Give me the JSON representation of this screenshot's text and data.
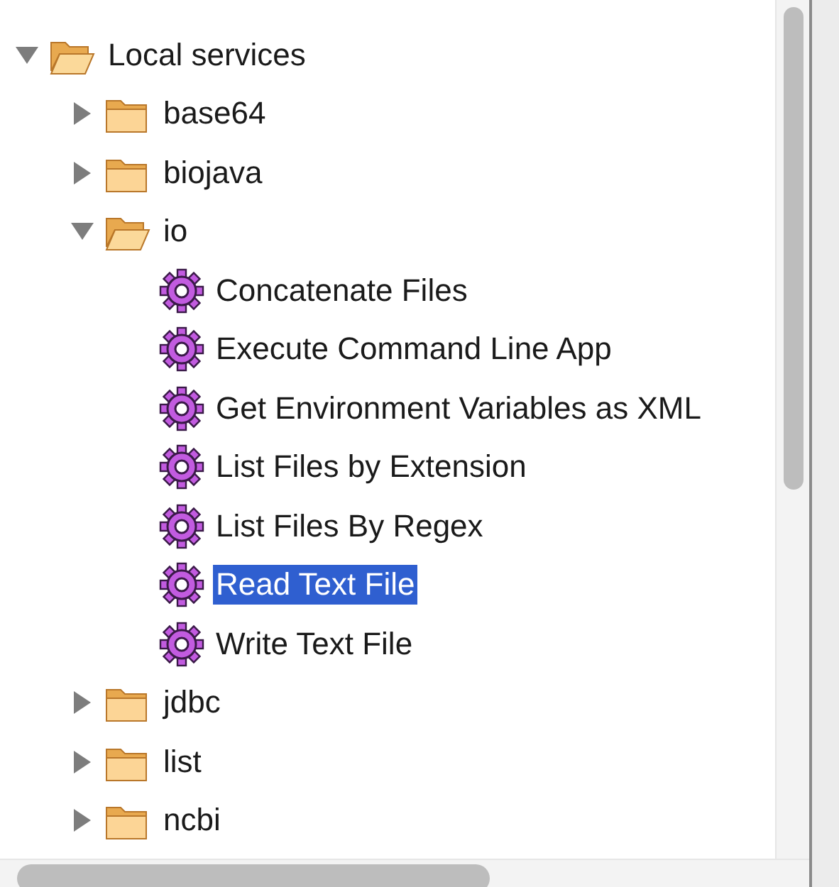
{
  "tree": [
    {
      "kind": "folder",
      "label": "Local services",
      "expanded": true,
      "selected": false,
      "children": [
        {
          "kind": "folder",
          "label": "base64",
          "expanded": false,
          "selected": false
        },
        {
          "kind": "folder",
          "label": "biojava",
          "expanded": false,
          "selected": false
        },
        {
          "kind": "folder",
          "label": "io",
          "expanded": true,
          "selected": false,
          "children": [
            {
              "kind": "service",
              "label": "Concatenate Files",
              "selected": false
            },
            {
              "kind": "service",
              "label": "Execute Command Line App",
              "selected": false
            },
            {
              "kind": "service",
              "label": "Get Environment Variables as XML",
              "selected": false
            },
            {
              "kind": "service",
              "label": "List Files by Extension",
              "selected": false
            },
            {
              "kind": "service",
              "label": "List Files By Regex",
              "selected": false
            },
            {
              "kind": "service",
              "label": "Read Text File",
              "selected": true
            },
            {
              "kind": "service",
              "label": "Write Text File",
              "selected": false
            }
          ]
        },
        {
          "kind": "folder",
          "label": "jdbc",
          "expanded": false,
          "selected": false
        },
        {
          "kind": "folder",
          "label": "list",
          "expanded": false,
          "selected": false
        },
        {
          "kind": "folder",
          "label": "ncbi",
          "expanded": false,
          "selected": false
        }
      ]
    }
  ]
}
